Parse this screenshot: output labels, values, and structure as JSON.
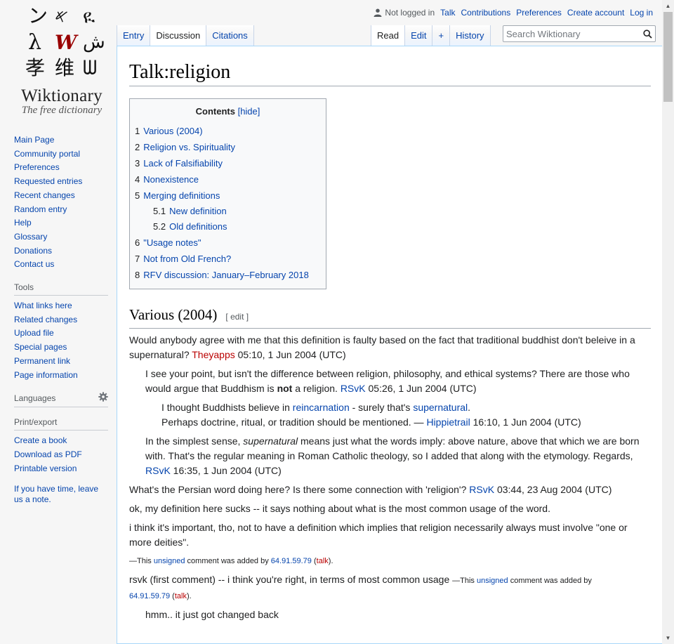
{
  "logo": {
    "glyphs": [
      "ン",
      "𐤀",
      "ዪ",
      "λ",
      "W",
      "ش",
      "孝",
      "维",
      "ᗯ"
    ],
    "name": "Wiktionary",
    "tagline": "The free dictionary"
  },
  "personal": {
    "not_logged_in": "Not logged in",
    "talk": "Talk",
    "contributions": "Contributions",
    "preferences": "Preferences",
    "create_account": "Create account",
    "log_in": "Log in"
  },
  "tabs": {
    "left": [
      "Entry",
      "Discussion",
      "Citations"
    ],
    "right": [
      "Read",
      "Edit",
      "+",
      "History"
    ]
  },
  "search": {
    "placeholder": "Search Wiktionary"
  },
  "sidebar": {
    "navigation": [
      "Main Page",
      "Community portal",
      "Preferences",
      "Requested entries",
      "Recent changes",
      "Random entry",
      "Help",
      "Glossary",
      "Donations",
      "Contact us"
    ],
    "tools_heading": "Tools",
    "tools": [
      "What links here",
      "Related changes",
      "Upload file",
      "Special pages",
      "Permanent link",
      "Page information"
    ],
    "languages_heading": "Languages",
    "print_heading": "Print/export",
    "print": [
      "Create a book",
      "Download as PDF",
      "Printable version"
    ],
    "note": "If you have time, leave us a note."
  },
  "page": {
    "title": "Talk:religion",
    "toc": {
      "title": "Contents",
      "hide": "[hide]",
      "items": [
        {
          "num": "1",
          "label": "Various (2004)"
        },
        {
          "num": "2",
          "label": "Religion vs. Spirituality"
        },
        {
          "num": "3",
          "label": "Lack of Falsifiability"
        },
        {
          "num": "4",
          "label": "Nonexistence"
        },
        {
          "num": "5",
          "label": "Merging definitions"
        },
        {
          "num": "5.1",
          "label": "New definition"
        },
        {
          "num": "5.2",
          "label": "Old definitions"
        },
        {
          "num": "6",
          "label": "\"Usage notes\""
        },
        {
          "num": "7",
          "label": "Not from Old French?"
        },
        {
          "num": "8",
          "label": "RFV discussion: January–February 2018"
        }
      ]
    },
    "section1": {
      "heading": "Various (2004)",
      "edit": "[ edit ]",
      "p1_text": "Would anybody agree with me that this definition is faulty based on the fact that traditional buddhist don't beleive in a supernatural? ",
      "p1_user": "Theyapps",
      "p1_sig": " 05:10, 1 Jun 2004 (UTC)",
      "p2_a": "I see your point, but isn't the difference between religion, philosophy, and ethical systems? There are those who would argue that Buddhism is ",
      "p2_bold": "not",
      "p2_b": " a religion. ",
      "p2_user": "RSvK",
      "p2_sig": " 05:26, 1 Jun 2004 (UTC)",
      "p3_a": "I thought Buddhists believe in ",
      "p3_link1": "reincarnation",
      "p3_b": " - surely that's ",
      "p3_link2": "supernatural",
      "p3_c": ".",
      "p4_a": "Perhaps doctrine, ritual, or tradition should be mentioned. — ",
      "p4_user": "Hippietrail",
      "p4_sig": " 16:10, 1 Jun 2004 (UTC)",
      "p5_a": "In the simplest sense, ",
      "p5_italic": "supernatural",
      "p5_b": " means just what the words imply: above nature, above that which we are born with. That's the regular meaning in Roman Catholic theology, so I added that along with the etymology. Regards, ",
      "p5_user": "RSvK",
      "p5_sig": " 16:35, 1 Jun 2004 (UTC)",
      "p6_a": "What's the Persian word doing here? Is there some connection with 'religion'? ",
      "p6_user": "RSvK",
      "p6_sig": " 03:44, 23 Aug 2004 (UTC)",
      "p7": "ok, my definition here sucks -- it says nothing about what is the most common usage of the word.",
      "p8": "i think it's important, tho, not to have a definition which implies that religion necessarily always must involve \"one or more deities\".",
      "p9_a": "—This ",
      "p9_unsigned": "unsigned",
      "p9_b": " comment was added by ",
      "p9_ip": "64.91.59.79",
      "p9_c": " (",
      "p9_talk": "talk",
      "p9_d": ").",
      "p10_a": "rsvk (first comment) -- i think you're right, in terms of most common usage ",
      "p10_small_a": "—This ",
      "p10_unsigned": "unsigned",
      "p10_small_b": " comment was added by",
      "p10_ip": "64.91.59.79",
      "p10_c": " (",
      "p10_talk": "talk",
      "p10_d": ").",
      "p11": "hmm.. it just got changed back"
    }
  }
}
